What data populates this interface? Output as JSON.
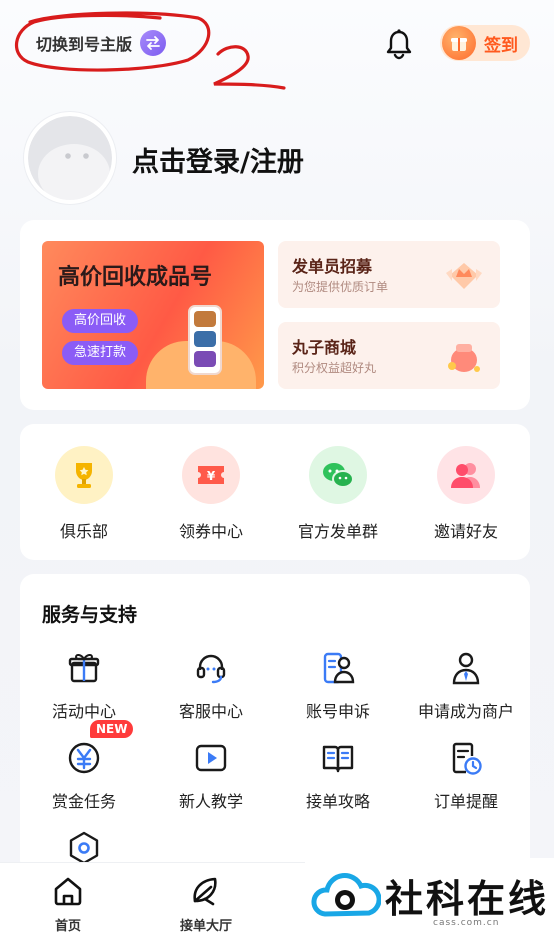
{
  "header": {
    "switch_label": "切换到号主版",
    "signin_label": "签到",
    "annotation_mark": "2"
  },
  "profile": {
    "login_label": "点击登录/注册"
  },
  "banner": {
    "title": "高价回收成品号",
    "tags": [
      "高价回收",
      "急速打款"
    ]
  },
  "promos": [
    {
      "title": "发单员招募",
      "subtitle": "为您提供优质订单"
    },
    {
      "title": "丸子商城",
      "subtitle": "积分权益超好丸"
    }
  ],
  "quick_links": [
    {
      "label": "俱乐部",
      "icon": "trophy-icon",
      "color": "#fff2c4"
    },
    {
      "label": "领券中心",
      "icon": "coupon-icon",
      "color": "#ffe3df"
    },
    {
      "label": "官方发单群",
      "icon": "wechat-icon",
      "color": "#dff7e3"
    },
    {
      "label": "邀请好友",
      "icon": "people-icon",
      "color": "#ffe3e6"
    }
  ],
  "services": {
    "title": "服务与支持",
    "items": [
      {
        "label": "活动中心",
        "icon": "gift-icon"
      },
      {
        "label": "客服中心",
        "icon": "headset-icon"
      },
      {
        "label": "账号申诉",
        "icon": "account-appeal-icon"
      },
      {
        "label": "申请成为商户",
        "icon": "merchant-icon"
      },
      {
        "label": "赏金任务",
        "icon": "bounty-yen-icon",
        "badge": "NEW"
      },
      {
        "label": "新人教学",
        "icon": "video-play-icon"
      },
      {
        "label": "接单攻略",
        "icon": "book-icon"
      },
      {
        "label": "订单提醒",
        "icon": "order-clock-icon"
      },
      {
        "label": "",
        "icon": "settings-hexagon-icon"
      }
    ]
  },
  "tabbar": {
    "items": [
      {
        "label": "首页",
        "icon": "home-icon"
      },
      {
        "label": "接单大厅",
        "icon": "leaf-hall-icon"
      }
    ]
  },
  "watermark": {
    "text": "社科在线",
    "url": "cass.com.cn"
  },
  "colors": {
    "accent_orange": "#ff5a1f",
    "accent_purple": "#8b5cf6",
    "annotation_red": "#d81c1c"
  }
}
